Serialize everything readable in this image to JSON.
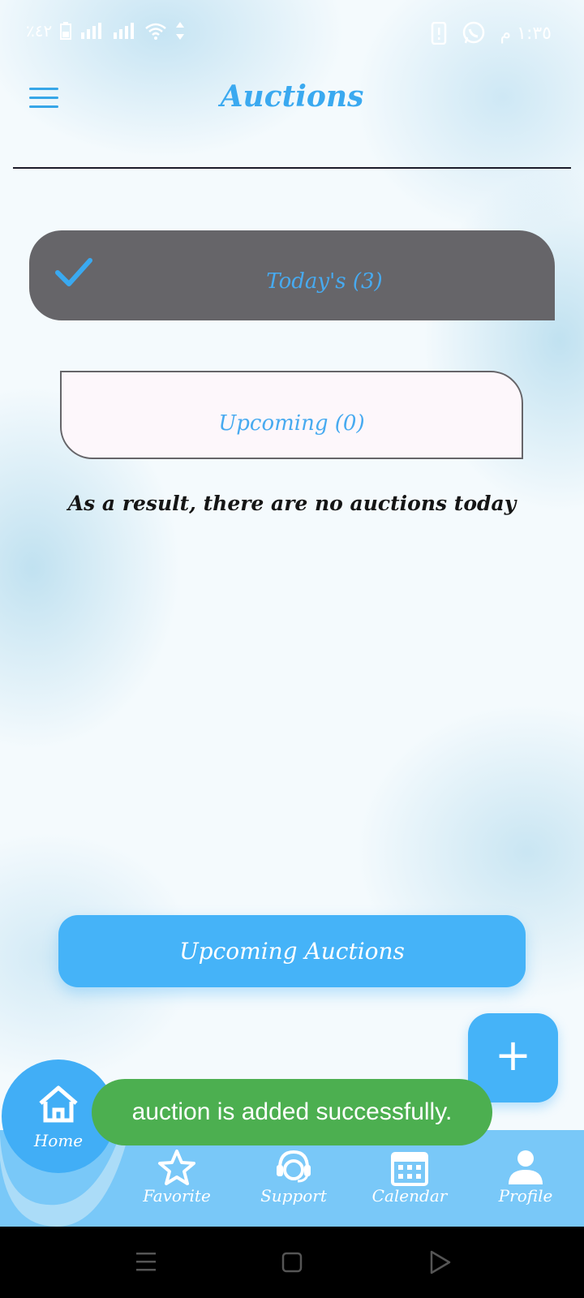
{
  "status_bar": {
    "battery": "٪٤٢",
    "time": "١:٣٥ م"
  },
  "header": {
    "title": "Auctions"
  },
  "tabs": {
    "today": "Today's (3)",
    "upcoming": "Upcoming (0)"
  },
  "empty_message": "As a result, there are no auctions today",
  "upcoming_button": "Upcoming Auctions",
  "fab": {
    "icon": "plus-icon"
  },
  "toast": "auction is added successfully.",
  "bottom_nav": {
    "home": "Home",
    "favorite": "Favorite",
    "support": "Support",
    "calendar": "Calendar",
    "profile": "Profile"
  },
  "colors": {
    "accent": "#45b3f8",
    "tab_active_bg": "#666569",
    "toast_bg": "#4caf50",
    "nav_bg": "#79c8f8"
  }
}
